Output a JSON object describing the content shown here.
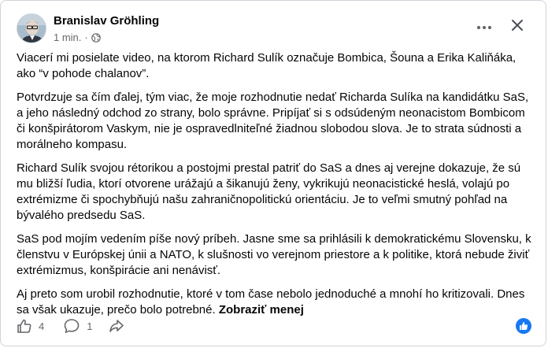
{
  "post": {
    "author": "Branislav Gröhling",
    "time": "1 min.",
    "separator": "·",
    "paragraphs": [
      "Viacerí mi posielate video, na ktorom Richard Sulík označuje Bombica, Šouna a Erika Kaliňáka, ako “v pohode chalanov”.",
      "Potvrdzuje sa čím ďalej, tým viac, že moje rozhodnutie nedať Richarda Sulíka na kandidátku SaS, a jeho následný odchod zo strany, bolo správne. Pripíjať si s odsúdeným neonacistom Bombicom či konšpirátorom Vaskym, nie je ospravedlniteľné žiadnou slobodou slova. Je to strata súdnosti a morálneho kompasu.",
      "Richard Sulík svojou rétorikou a postojmi prestal patriť do SaS a dnes aj verejne dokazuje, že sú mu bližší ľudia, ktorí otvorene urážajú a šikanujú ženy, vykrikujú neonacistické heslá, volajú po extrémizme či spochybňujú našu zahraničnopolitickú orientáciu. Je to veľmi smutný pohľad na bývalého predsedu SaS.",
      "SaS pod mojím vedením píše nový príbeh. Jasne sme sa prihlásili k demokratickému Slovensku, k členstvu v Európskej únii a NATO, k slušnosti vo verejnom priestore a k politike, ktorá nebude živiť extrémizmus, konšpirácie ani nenávisť.",
      "Aj preto som urobil rozhodnutie, ktoré v tom čase nebolo jednoduché a mnohí ho kritizovali. Dnes sa však ukazuje, prečo bolo potrebné."
    ],
    "see_more": "Zobraziť menej"
  },
  "actions": {
    "like_count": "4",
    "comment_count": "1"
  },
  "icons": {
    "audience": "globe-icon",
    "more": "more-options-icon",
    "close": "close-icon",
    "like": "thumbs-up-icon",
    "comment": "comment-icon",
    "share": "share-icon",
    "reaction": "like-reaction-icon"
  },
  "colors": {
    "text": "#050505",
    "secondary": "#65676b",
    "accent": "#1877f2"
  }
}
